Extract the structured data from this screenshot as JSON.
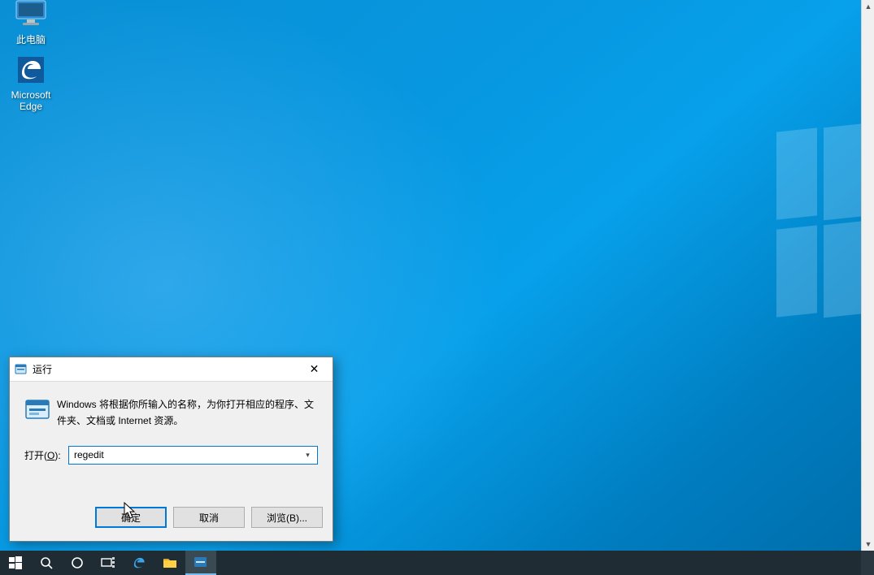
{
  "desktop_icons": {
    "this_pc": {
      "label": "此电脑"
    },
    "edge": {
      "label": "Microsoft\nEdge"
    }
  },
  "run_dialog": {
    "title": "运行",
    "description": "Windows 将根据你所输入的名称，为你打开相应的程序、文件夹、文档或 Internet 资源。",
    "open_label_prefix": "打开(",
    "open_label_underline": "O",
    "open_label_suffix": "):",
    "input_value": "regedit",
    "buttons": {
      "ok": "确定",
      "cancel": "取消",
      "browse": "浏览(B)..."
    },
    "close_glyph": "✕"
  },
  "taskbar": {
    "start": "start-icon",
    "search": "search-icon",
    "cortana": "cortana-icon",
    "taskview": "taskview-icon",
    "edge": "edge-icon",
    "explorer": "file-explorer-icon",
    "run": "run-app-icon"
  },
  "icons": {
    "run_small": "run-icon",
    "run_large": "run-icon",
    "chevron_down": "▾"
  }
}
